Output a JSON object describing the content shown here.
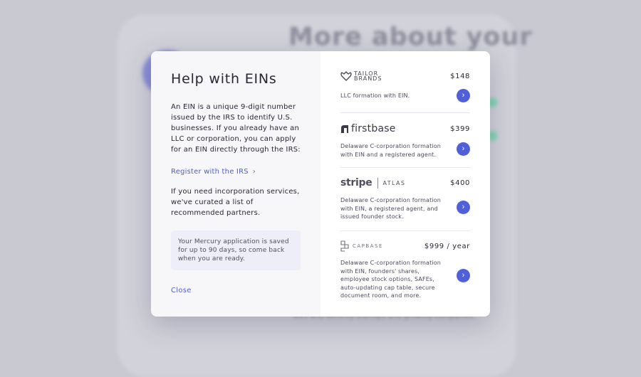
{
  "background": {
    "title": "More about your",
    "footer_text": "ales and security startups and growing companies."
  },
  "modal": {
    "title": "Help with EINs",
    "intro": "An EIN is a unique 9-digit number issued by the IRS to identify U.S. businesses. If you already have an LLC or corporation, you can apply for an EIN directly through the IRS:",
    "irs_link": "Register with the IRS",
    "partners_intro": "If you need incorporation services, we've curated a list of recommended partners.",
    "note": "Your Mercury application is saved for up to 90 days, so come back when you are ready.",
    "close_label": "Close"
  },
  "partners": [
    {
      "logo_top": "TAILOR",
      "logo_bottom": "BRANDS",
      "price": "$148",
      "description": "LLC formation with EIN.",
      "icon": "tailor-brands-logo"
    },
    {
      "logo": "firstbase",
      "price": "$399",
      "description": "Delaware C-corporation formation with EIN and a registered agent.",
      "icon": "firstbase-logo"
    },
    {
      "logo": "stripe",
      "logo_suffix": "ATLAS",
      "price": "$400",
      "description": "Delaware C-corporation formation with EIN, a registered agent, and issued founder stock.",
      "icon": "stripe-atlas-logo"
    },
    {
      "logo": "CAPBASE",
      "price": "$999 / year",
      "description": "Delaware C-corporation formation with EIN, founders' shares, employee stock options, SAFEs, auto-updating cap table, secure document room, and more.",
      "icon": "capbase-logo"
    }
  ],
  "colors": {
    "accent": "#5060d8",
    "link": "#4f5ec9",
    "overlay": "#c9c9d2"
  }
}
